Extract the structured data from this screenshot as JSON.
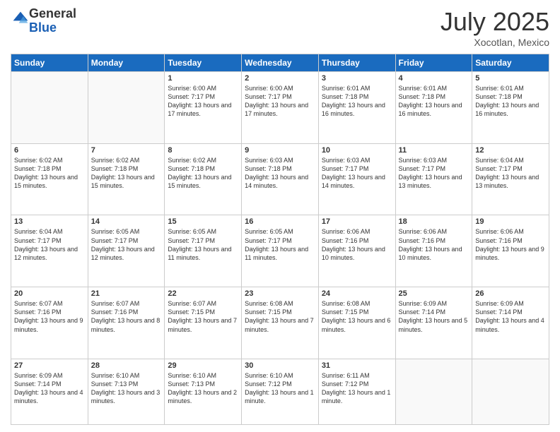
{
  "header": {
    "logo_general": "General",
    "logo_blue": "Blue",
    "month_title": "July 2025",
    "location": "Xocotlan, Mexico"
  },
  "days_of_week": [
    "Sunday",
    "Monday",
    "Tuesday",
    "Wednesday",
    "Thursday",
    "Friday",
    "Saturday"
  ],
  "weeks": [
    [
      {
        "day": "",
        "text": ""
      },
      {
        "day": "",
        "text": ""
      },
      {
        "day": "1",
        "text": "Sunrise: 6:00 AM\nSunset: 7:17 PM\nDaylight: 13 hours and 17 minutes."
      },
      {
        "day": "2",
        "text": "Sunrise: 6:00 AM\nSunset: 7:17 PM\nDaylight: 13 hours and 17 minutes."
      },
      {
        "day": "3",
        "text": "Sunrise: 6:01 AM\nSunset: 7:18 PM\nDaylight: 13 hours and 16 minutes."
      },
      {
        "day": "4",
        "text": "Sunrise: 6:01 AM\nSunset: 7:18 PM\nDaylight: 13 hours and 16 minutes."
      },
      {
        "day": "5",
        "text": "Sunrise: 6:01 AM\nSunset: 7:18 PM\nDaylight: 13 hours and 16 minutes."
      }
    ],
    [
      {
        "day": "6",
        "text": "Sunrise: 6:02 AM\nSunset: 7:18 PM\nDaylight: 13 hours and 15 minutes."
      },
      {
        "day": "7",
        "text": "Sunrise: 6:02 AM\nSunset: 7:18 PM\nDaylight: 13 hours and 15 minutes."
      },
      {
        "day": "8",
        "text": "Sunrise: 6:02 AM\nSunset: 7:18 PM\nDaylight: 13 hours and 15 minutes."
      },
      {
        "day": "9",
        "text": "Sunrise: 6:03 AM\nSunset: 7:18 PM\nDaylight: 13 hours and 14 minutes."
      },
      {
        "day": "10",
        "text": "Sunrise: 6:03 AM\nSunset: 7:17 PM\nDaylight: 13 hours and 14 minutes."
      },
      {
        "day": "11",
        "text": "Sunrise: 6:03 AM\nSunset: 7:17 PM\nDaylight: 13 hours and 13 minutes."
      },
      {
        "day": "12",
        "text": "Sunrise: 6:04 AM\nSunset: 7:17 PM\nDaylight: 13 hours and 13 minutes."
      }
    ],
    [
      {
        "day": "13",
        "text": "Sunrise: 6:04 AM\nSunset: 7:17 PM\nDaylight: 13 hours and 12 minutes."
      },
      {
        "day": "14",
        "text": "Sunrise: 6:05 AM\nSunset: 7:17 PM\nDaylight: 13 hours and 12 minutes."
      },
      {
        "day": "15",
        "text": "Sunrise: 6:05 AM\nSunset: 7:17 PM\nDaylight: 13 hours and 11 minutes."
      },
      {
        "day": "16",
        "text": "Sunrise: 6:05 AM\nSunset: 7:17 PM\nDaylight: 13 hours and 11 minutes."
      },
      {
        "day": "17",
        "text": "Sunrise: 6:06 AM\nSunset: 7:16 PM\nDaylight: 13 hours and 10 minutes."
      },
      {
        "day": "18",
        "text": "Sunrise: 6:06 AM\nSunset: 7:16 PM\nDaylight: 13 hours and 10 minutes."
      },
      {
        "day": "19",
        "text": "Sunrise: 6:06 AM\nSunset: 7:16 PM\nDaylight: 13 hours and 9 minutes."
      }
    ],
    [
      {
        "day": "20",
        "text": "Sunrise: 6:07 AM\nSunset: 7:16 PM\nDaylight: 13 hours and 9 minutes."
      },
      {
        "day": "21",
        "text": "Sunrise: 6:07 AM\nSunset: 7:16 PM\nDaylight: 13 hours and 8 minutes."
      },
      {
        "day": "22",
        "text": "Sunrise: 6:07 AM\nSunset: 7:15 PM\nDaylight: 13 hours and 7 minutes."
      },
      {
        "day": "23",
        "text": "Sunrise: 6:08 AM\nSunset: 7:15 PM\nDaylight: 13 hours and 7 minutes."
      },
      {
        "day": "24",
        "text": "Sunrise: 6:08 AM\nSunset: 7:15 PM\nDaylight: 13 hours and 6 minutes."
      },
      {
        "day": "25",
        "text": "Sunrise: 6:09 AM\nSunset: 7:14 PM\nDaylight: 13 hours and 5 minutes."
      },
      {
        "day": "26",
        "text": "Sunrise: 6:09 AM\nSunset: 7:14 PM\nDaylight: 13 hours and 4 minutes."
      }
    ],
    [
      {
        "day": "27",
        "text": "Sunrise: 6:09 AM\nSunset: 7:14 PM\nDaylight: 13 hours and 4 minutes."
      },
      {
        "day": "28",
        "text": "Sunrise: 6:10 AM\nSunset: 7:13 PM\nDaylight: 13 hours and 3 minutes."
      },
      {
        "day": "29",
        "text": "Sunrise: 6:10 AM\nSunset: 7:13 PM\nDaylight: 13 hours and 2 minutes."
      },
      {
        "day": "30",
        "text": "Sunrise: 6:10 AM\nSunset: 7:12 PM\nDaylight: 13 hours and 1 minute."
      },
      {
        "day": "31",
        "text": "Sunrise: 6:11 AM\nSunset: 7:12 PM\nDaylight: 13 hours and 1 minute."
      },
      {
        "day": "",
        "text": ""
      },
      {
        "day": "",
        "text": ""
      }
    ]
  ]
}
